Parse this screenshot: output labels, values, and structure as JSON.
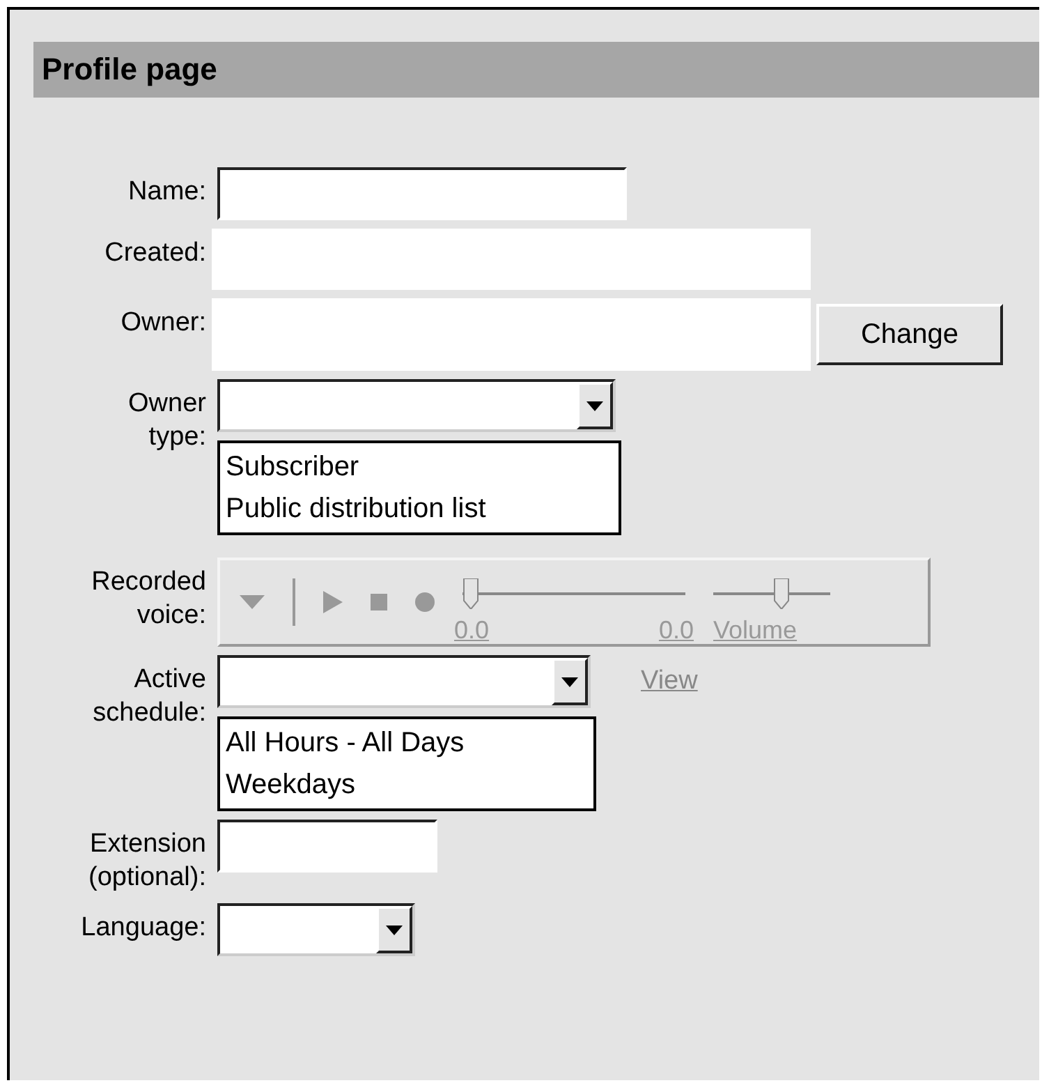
{
  "title": "Profile page",
  "fields": [
    {
      "kind": "input",
      "label": "Name:"
    },
    {
      "kind": "readonly",
      "label": "Created:"
    },
    {
      "kind": "readonly",
      "label": "Owner:",
      "button": "Change"
    },
    {
      "kind": "select",
      "label": "Owner\ntype:",
      "options": [
        "Subscriber",
        "Public distribution list"
      ]
    },
    {
      "kind": "player",
      "label": "Recorded\nvoice:",
      "position": {
        "level": 0,
        "start": "0.0",
        "end": "0.0"
      },
      "volume": {
        "level": 0.6,
        "label": "Volume"
      }
    },
    {
      "kind": "select",
      "label": "Active\nschedule:",
      "link": "View",
      "options": [
        "All Hours - All Days",
        "Weekdays"
      ]
    },
    {
      "kind": "input",
      "label": "Extension\n(optional):"
    },
    {
      "kind": "select",
      "label": "Language:"
    }
  ]
}
